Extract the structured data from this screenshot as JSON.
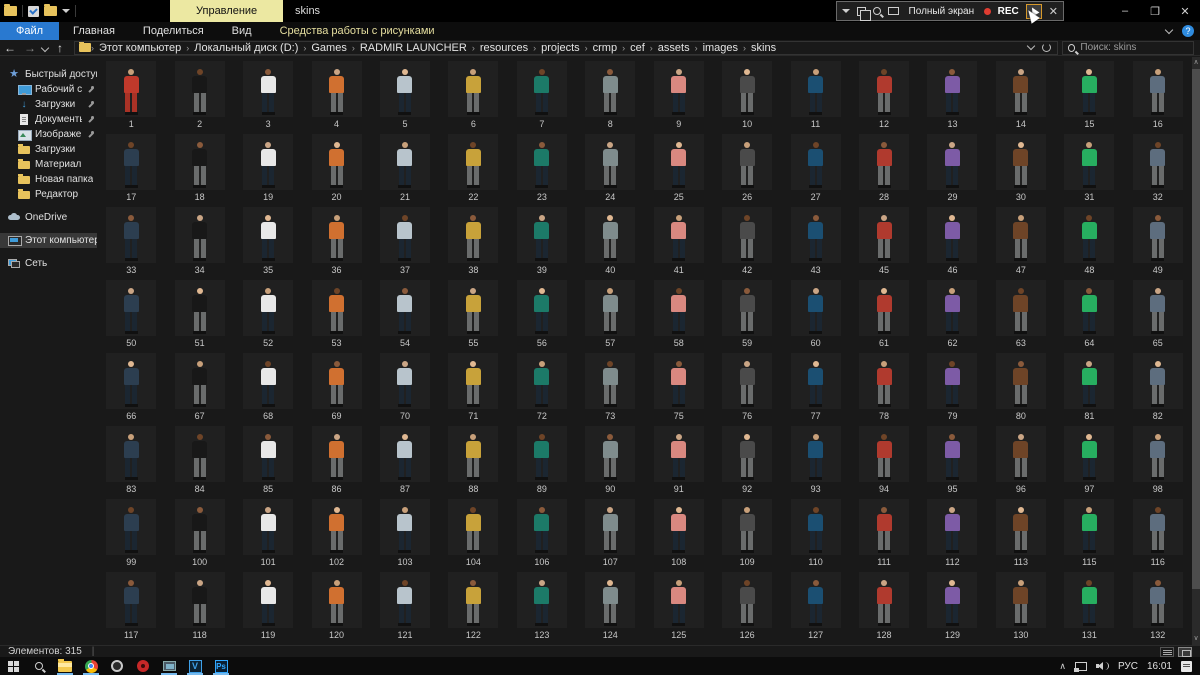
{
  "titlebar": {
    "manage_tab": "Управление",
    "window_title": "skins",
    "recorder": {
      "mode_label": "Полный экран",
      "rec_label": "REC",
      "close": "✕"
    },
    "caption": {
      "minimize": "–",
      "maximize": "❐",
      "close": "✕"
    }
  },
  "menu": {
    "tabs": [
      {
        "label": "Файл",
        "style": "file"
      },
      {
        "label": "Главная",
        "style": ""
      },
      {
        "label": "Поделиться",
        "style": ""
      },
      {
        "label": "Вид",
        "style": ""
      },
      {
        "label": "Средства работы с рисунками",
        "style": "ctx"
      }
    ],
    "help_glyph": "?"
  },
  "address": {
    "back": "←",
    "forward": "→",
    "up": "↑",
    "crumbs": [
      "Этот компьютер",
      "Локальный диск (D:)",
      "Games",
      "RADMIR LAUNCHER",
      "resources",
      "projects",
      "crmp",
      "cef",
      "assets",
      "images",
      "skins"
    ],
    "separator": "›",
    "search_placeholder": "Поиск: skins"
  },
  "sidebar": {
    "items": [
      {
        "label": "Быстрый доступ",
        "icon": "star",
        "level": 0,
        "pinned": false,
        "selected": false,
        "group": false
      },
      {
        "label": "Рабочий стол",
        "icon": "desktop",
        "level": 1,
        "pinned": true,
        "selected": false,
        "group": false
      },
      {
        "label": "Загрузки",
        "icon": "download",
        "level": 1,
        "pinned": true,
        "selected": false,
        "group": false
      },
      {
        "label": "Документы",
        "icon": "document",
        "level": 1,
        "pinned": true,
        "selected": false,
        "group": false
      },
      {
        "label": "Изображения",
        "icon": "pictures",
        "level": 1,
        "pinned": true,
        "selected": false,
        "group": false
      },
      {
        "label": "Загрузки",
        "icon": "folder",
        "level": 1,
        "pinned": false,
        "selected": false,
        "group": false
      },
      {
        "label": "Материал",
        "icon": "folder",
        "level": 1,
        "pinned": false,
        "selected": false,
        "group": false
      },
      {
        "label": "Новая папка",
        "icon": "folder",
        "level": 1,
        "pinned": false,
        "selected": false,
        "group": false
      },
      {
        "label": "Редактор",
        "icon": "folder",
        "level": 1,
        "pinned": false,
        "selected": false,
        "group": false
      },
      {
        "label": "OneDrive",
        "icon": "onedrive",
        "level": 0,
        "pinned": false,
        "selected": false,
        "group": true
      },
      {
        "label": "Этот компьютер",
        "icon": "computer",
        "level": 0,
        "pinned": false,
        "selected": true,
        "group": true
      },
      {
        "label": "Сеть",
        "icon": "network",
        "level": 0,
        "pinned": false,
        "selected": false,
        "group": true
      }
    ]
  },
  "grid": {
    "numbers": [
      1,
      2,
      3,
      4,
      5,
      6,
      7,
      8,
      9,
      10,
      11,
      12,
      13,
      14,
      15,
      16,
      17,
      18,
      19,
      20,
      21,
      22,
      23,
      24,
      25,
      26,
      27,
      28,
      29,
      30,
      31,
      32,
      33,
      34,
      35,
      36,
      37,
      38,
      39,
      40,
      41,
      42,
      43,
      45,
      46,
      47,
      48,
      49,
      50,
      51,
      52,
      53,
      54,
      55,
      56,
      57,
      58,
      59,
      60,
      61,
      62,
      63,
      64,
      65,
      66,
      67,
      68,
      69,
      70,
      71,
      72,
      73,
      75,
      76,
      77,
      78,
      79,
      80,
      81,
      82,
      83,
      84,
      85,
      86,
      87,
      88,
      89,
      90,
      91,
      92,
      93,
      94,
      95,
      96,
      97,
      98,
      99,
      100,
      101,
      102,
      103,
      104,
      106,
      107,
      108,
      109,
      110,
      111,
      112,
      113,
      115,
      116,
      117,
      118,
      119,
      120,
      121,
      122,
      123,
      124,
      125,
      126,
      127,
      128,
      129,
      130,
      131,
      132
    ],
    "palette": {
      "skins": [
        "#c8a07a",
        "#8a5a3b",
        "#e0b892",
        "#6e4427",
        "#caa585"
      ],
      "shirts": [
        "#b03a2e",
        "#e8e8e8",
        "#4a4a4a",
        "#2c3e50",
        "#7f8c8d",
        "#27ae60",
        "#c8a23a",
        "#7d5ba6",
        "#d07030",
        "#1b4f72",
        "#181818",
        "#d98880",
        "#5d6d7e",
        "#1c7a68",
        "#6e4427",
        "#b8c4cc"
      ],
      "pants": [
        "#2c3e50",
        "#1b2631",
        "#5a3a1a",
        "#515a5a",
        "#1a5276",
        "#141414",
        "#6a6c6c",
        "#3d4a4e",
        "#21618c",
        "#303030"
      ]
    },
    "overrides": {
      "1": [
        "#c0392b",
        "#a93226"
      ]
    }
  },
  "statusbar": {
    "items_label": "Элементов: 315",
    "separator": "|"
  },
  "taskbar": {
    "apps": [
      {
        "name": "start",
        "running": false
      },
      {
        "name": "search",
        "running": false
      },
      {
        "name": "explorer",
        "running": true
      },
      {
        "name": "chrome",
        "running": true
      },
      {
        "name": "obs",
        "running": false
      },
      {
        "name": "recorder",
        "running": false
      },
      {
        "name": "photos",
        "running": true
      },
      {
        "name": "video-editor",
        "running": true
      },
      {
        "name": "photoshop",
        "running": true
      }
    ],
    "app_glyphs": {
      "video-editor": "V",
      "photoshop": "Ps"
    },
    "tray": {
      "lang": "РУС",
      "time": "16:01"
    }
  },
  "colors": {
    "accent_blue": "#2979d0",
    "manage_yellow": "#ece8a2",
    "rec_red": "#e03c31",
    "underline_blue": "#76b9ed"
  }
}
